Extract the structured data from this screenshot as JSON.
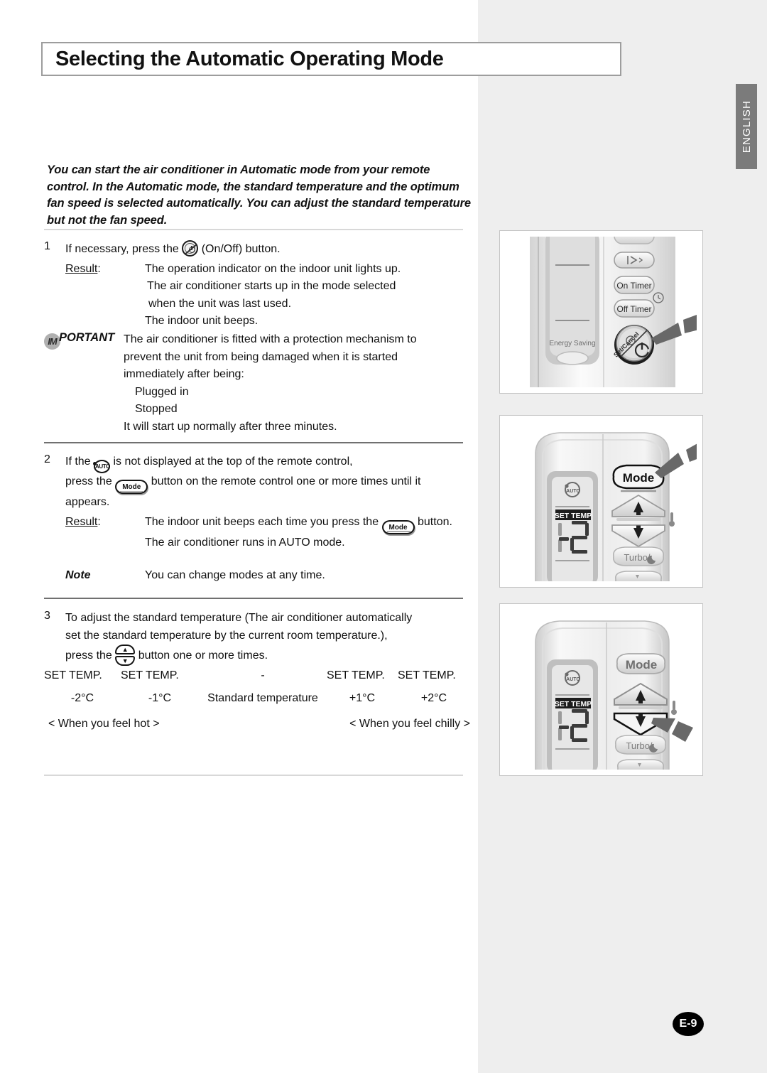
{
  "page": {
    "title": "Selecting the Automatic Operating Mode",
    "language_tab": "ENGLISH",
    "page_number": "E-9"
  },
  "intro": "You can start the air conditioner in Automatic mode from your remote control. In the Automatic mode, the standard temperature and the optimum fan speed is selected automatically. You can adjust the standard temperature but not the fan speed.",
  "step1": {
    "number": "1",
    "text_before": "If necessary, press the",
    "text_after": "(On/Off) button.",
    "result_label": "Result",
    "result_colon": ":",
    "result_lines": [
      "The operation indicator on the indoor unit lights up.",
      "The air conditioner starts up in the mode selected",
      "when the unit was last used.",
      "The indoor unit beeps."
    ]
  },
  "important": {
    "label_circle": "IM",
    "label_rest": "PORTANT",
    "lines": [
      "The air conditioner is fitted with a protection mechanism to",
      "prevent the unit from being damaged when it is started",
      "immediately after being:"
    ],
    "bullets": [
      "Plugged in",
      "Stopped"
    ],
    "closing": "It will start up normally after three minutes."
  },
  "step2": {
    "number": "2",
    "line1_before": "If the",
    "line1_after": "is not displayed at the top of the remote control,",
    "line2_before": "press the",
    "line2_after": "button on the remote control one or more times until it",
    "line3": "appears.",
    "result_label": "Result",
    "result_colon": ":",
    "result_line1_before": "The indoor unit beeps each time you press the",
    "result_line1_after": "button.",
    "result_line2": "The air conditioner runs in AUTO mode.",
    "note_label": "Note",
    "note_text": "You can change modes at any time."
  },
  "step3": {
    "number": "3",
    "line1": "To adjust the standard temperature (The air conditioner automatically",
    "line2": "set the standard temperature by the current room temperature.),",
    "line3_before": "press the",
    "line3_after": "button one or more times."
  },
  "temp_table": {
    "row_labels": [
      "SET TEMP.",
      "SET TEMP.",
      "-",
      "SET TEMP.",
      "SET TEMP."
    ],
    "row_values": [
      "-2°C",
      "-1°C",
      "Standard temperature",
      "+1°C",
      "+2°C"
    ],
    "footnote_left": "< When you feel hot >",
    "footnote_right": "< When you feel chilly >"
  },
  "figures": {
    "fig1": {
      "name": "remote-onoff-detail",
      "labels": {
        "on_timer": "On Timer",
        "off_timer": "Off Timer",
        "energy_saving": "Energy Saving",
        "set_cancel": "Set/Cancel"
      }
    },
    "fig2": {
      "name": "remote-mode-detail",
      "labels": {
        "mode": "Mode",
        "set_temp": "SET TEMP",
        "turbo": "Turbo/",
        "auto": "AUTO",
        "display_value": "2"
      }
    },
    "fig3": {
      "name": "remote-temp-detail",
      "labels": {
        "mode": "Mode",
        "set_temp": "SET TEMP",
        "turbo": "Turbo/",
        "auto": "AUTO",
        "display_value": "2"
      }
    }
  },
  "colors": {
    "page_right_bg": "#eeeeee",
    "tab_bg": "#7b7b7b",
    "rule": "#d8d8d8",
    "remote_body": "#e8e8e8"
  }
}
